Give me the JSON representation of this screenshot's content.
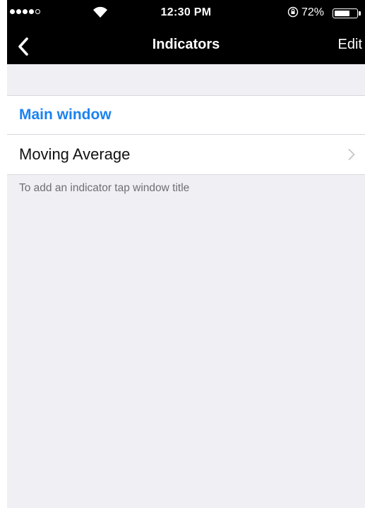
{
  "status_bar": {
    "time": "12:30 PM",
    "battery_percent": "72%",
    "battery_level": 0.72,
    "signal_dots_filled": 4,
    "signal_dots_total": 5
  },
  "nav": {
    "title": "Indicators",
    "edit_label": "Edit",
    "back_icon": "chevron-left-icon"
  },
  "list": {
    "section_title": "Main window",
    "items": [
      {
        "label": "Moving Average",
        "icon": "chevron-right-icon"
      }
    ]
  },
  "hint": "To add an indicator tap window title",
  "colors": {
    "accent": "#1a82f0",
    "background": "#efeff4",
    "bar": "#000000"
  }
}
